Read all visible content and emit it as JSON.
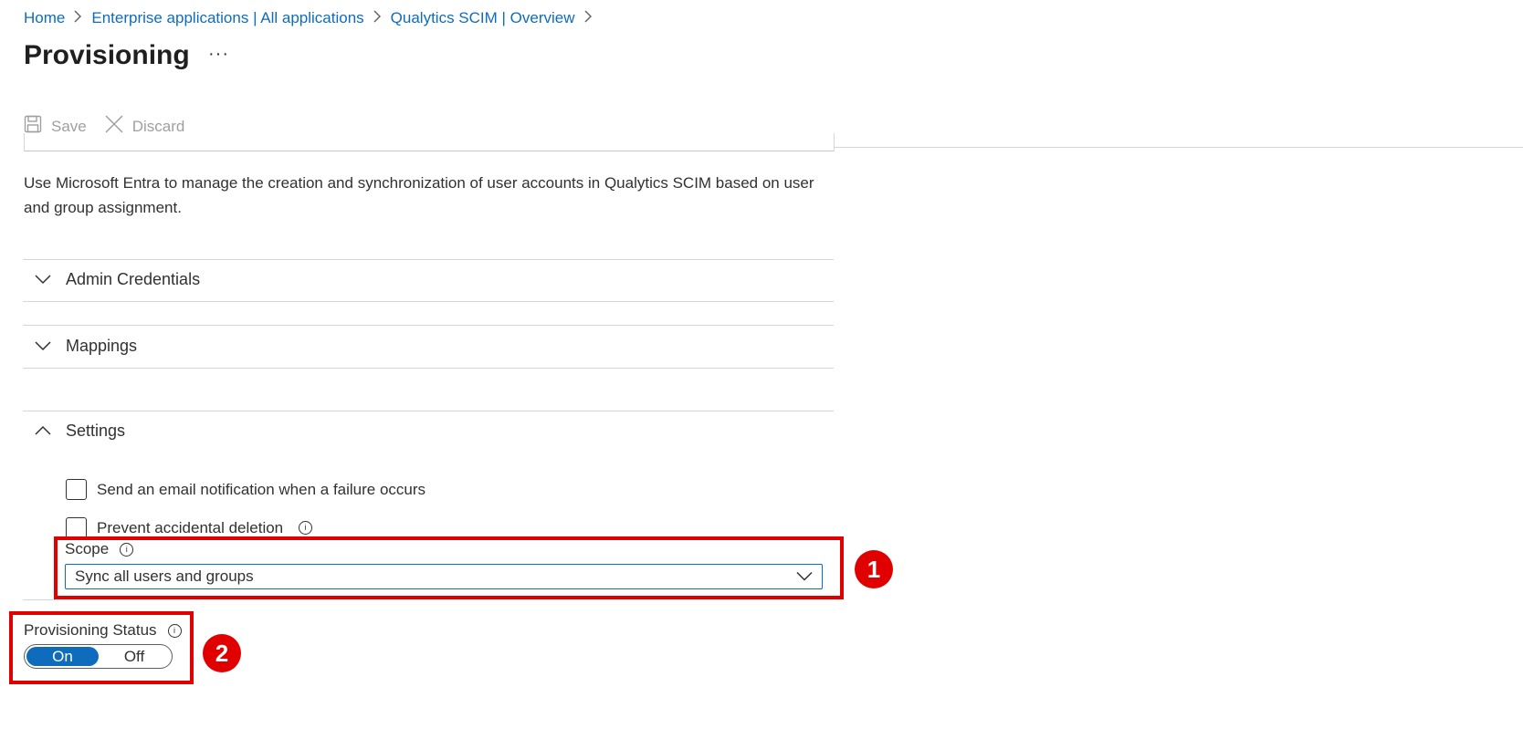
{
  "breadcrumb": {
    "home": "Home",
    "enterprise_apps": "Enterprise applications | All applications",
    "app_overview": "Qualytics SCIM | Overview",
    "separator": ">"
  },
  "page": {
    "title": "Provisioning",
    "more_label": "···"
  },
  "toolbar": {
    "save_label": "Save",
    "discard_label": "Discard"
  },
  "description": "Use Microsoft Entra to manage the creation and synchronization of user accounts in Qualytics SCIM based on user and group assignment.",
  "sections": {
    "admin_credentials": "Admin Credentials",
    "mappings": "Mappings",
    "settings": "Settings"
  },
  "settings": {
    "email_notification_label": "Send an email notification when a failure occurs",
    "email_notification_checked": false,
    "prevent_deletion_label": "Prevent accidental deletion",
    "prevent_deletion_checked": false,
    "scope_label": "Scope",
    "scope_value": "Sync all users and groups"
  },
  "provisioning_status": {
    "label": "Provisioning Status",
    "on_label": "On",
    "off_label": "Off",
    "selected": "On"
  },
  "annotations": {
    "badge_1": "1",
    "badge_2": "2"
  },
  "colors": {
    "link": "#0f6cbd",
    "accent": "#0f6cbd",
    "annotation": "#e00000"
  }
}
